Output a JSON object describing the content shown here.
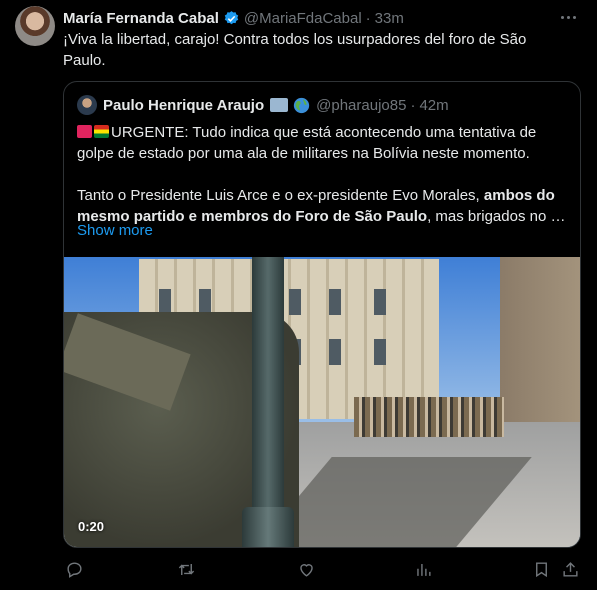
{
  "tweet": {
    "author_name": "María Fernanda Cabal",
    "author_handle": "@MariaFdaCabal",
    "separator": "·",
    "time": "33m",
    "text": "¡Viva la libertad, carajo! Contra todos los usurpadores del foro de São Paulo."
  },
  "quote": {
    "author_name": "Paulo Henrique Araujo",
    "author_handle": "@pharaujo85",
    "separator": "·",
    "time": "42m",
    "line1": "URGENTE: Tudo indica que está acontecendo uma tentativa de golpe de estado por uma ala de militares na Bolívia neste momento.",
    "line2_pre": "Tanto o Presidente Luis Arce e o ex-presidente Evo Morales, ",
    "line2_bold": "ambos do mesmo partido e membros do Foro de São Paulo",
    "line2_post": ", mas brigados no …",
    "show_more": "Show more",
    "video_time": "0:20"
  },
  "icons": {
    "verified": "verified-badge-icon",
    "more": "more-icon",
    "reply": "reply-icon",
    "retweet": "retweet-icon",
    "like": "like-icon",
    "views": "views-icon",
    "bookmark": "bookmark-icon",
    "share": "share-icon"
  },
  "colors": {
    "background": "#000000",
    "text": "#e7e9ea",
    "muted": "#71767b",
    "accent": "#1d9bf0",
    "border": "#2f3336"
  }
}
